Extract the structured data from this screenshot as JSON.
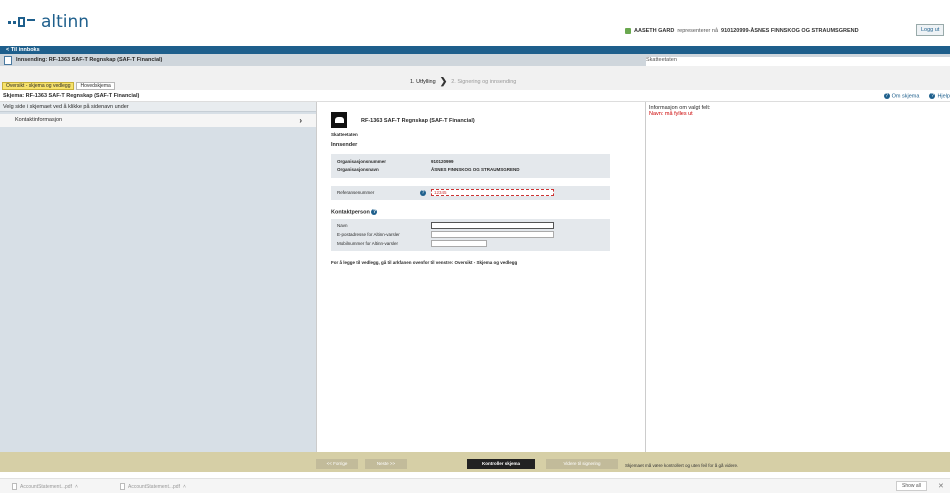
{
  "brand": {
    "name": "altinn",
    "color": "#1e5f8c"
  },
  "header": {
    "user_name": "AASETH GARD",
    "represents_text": "representerer nå",
    "org": "910120999-ÅSNES FINNSKOG OG STRAUMSGREND",
    "logout_label": "Logg ut"
  },
  "inbox_link": "< Til innboks",
  "doc_bar": {
    "title": "Innsending: RF-1363 SAF-T Regnskap (SAF-T Financial)",
    "right_label": "Skatteetaten"
  },
  "steps": {
    "step1": "1. Utfylling",
    "step2": "2. Signering og innsending"
  },
  "tabs": [
    {
      "label": "Oversikt - skjema og vedlegg"
    },
    {
      "label": "Hovedskjema"
    }
  ],
  "skjema_bar": {
    "label": "Skjema: RF-1363 SAF-T Regnskap (SAF-T Financial)",
    "links": [
      "Om skjema",
      "Hjelp"
    ]
  },
  "left_panel": {
    "header": "Velg side i skjemaet ved å klikke på sidenavn under",
    "items": [
      {
        "label": "Kontaktinformasjon"
      }
    ]
  },
  "form": {
    "title": "RF-1363 SAF-T Regnskap (SAF-T Financial)",
    "emblem_label": "Skatteetaten",
    "innsender_heading": "Innsender",
    "org_no_label": "Organisasjonsnummer",
    "org_no_value": "910120999",
    "org_name_label": "Organisasjonsnavn",
    "org_name_value": "ÅSNES FINNSKOG OG STRAUMSGREND",
    "ref_label": "Referansenummer",
    "ref_value": "12345",
    "contact_heading": "Kontaktperson",
    "contact_fields": [
      {
        "label": "Navn",
        "value": ""
      },
      {
        "label": "E-postadresse for Altinn-varsler",
        "value": ""
      },
      {
        "label": "Mobilnummer for Altinn-varsler",
        "value": ""
      }
    ],
    "note": "For å legge til vedlegg, gå til arkfanen ovenfor til venstre: Oversikt - Skjema og vedlegg"
  },
  "right_panel": {
    "title": "Informasjon om valgt felt:",
    "error": "Navn: må fylles ut"
  },
  "bottom": {
    "prev_label": "<< Forrige",
    "next_label": "Neste >>",
    "check_label": "Kontroller skjema",
    "forward_label": "Videre til signering",
    "message": "Skjemaet må være kontrollert og uten feil for å gå videre."
  },
  "downloads": {
    "items": [
      {
        "name": "AccountStatement...pdf"
      },
      {
        "name": "AccountStatement...pdf"
      }
    ],
    "show_all": "Show all"
  }
}
